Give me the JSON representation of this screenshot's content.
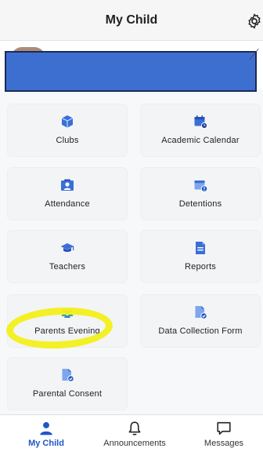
{
  "header": {
    "title": "My Child"
  },
  "colors": {
    "accent": "#1f56c8",
    "tile_bg": "#f3f4f6",
    "redaction": "#3d6fd1",
    "highlight": "#f2ef1a"
  },
  "tiles": [
    {
      "label": "Clubs",
      "icon": "box-icon"
    },
    {
      "label": "Academic Calendar",
      "icon": "calendar-icon"
    },
    {
      "label": "Attendance",
      "icon": "attendance-icon"
    },
    {
      "label": "Detentions",
      "icon": "detentions-icon"
    },
    {
      "label": "Teachers",
      "icon": "graduation-cap-icon"
    },
    {
      "label": "Reports",
      "icon": "report-icon"
    },
    {
      "label": "Parents Evening",
      "icon": "parents-group-icon"
    },
    {
      "label": "Data Collection Form",
      "icon": "form-check-icon"
    },
    {
      "label": "Parental Consent",
      "icon": "consent-check-icon"
    }
  ],
  "bottom_nav": {
    "items": [
      {
        "label": "My Child",
        "icon": "person-icon",
        "active": true
      },
      {
        "label": "Announcements",
        "icon": "bell-icon",
        "active": false
      },
      {
        "label": "Messages",
        "icon": "chat-icon",
        "active": false
      }
    ]
  }
}
